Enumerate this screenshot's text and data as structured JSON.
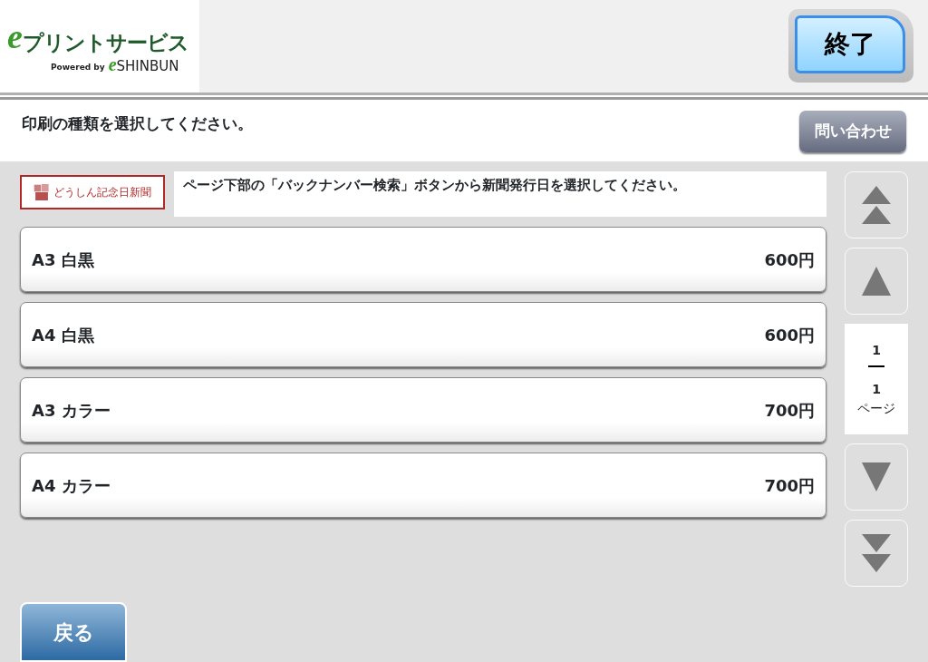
{
  "header": {
    "logo": {
      "mark": "e",
      "title": "プリントサービス",
      "powered_by": "Powered by",
      "brand_mark": "e",
      "brand": "SHINBUN"
    },
    "exit_button": "終了"
  },
  "instruction": "印刷の種類を選択してください。",
  "contact_button": "問い合わせ",
  "notice": {
    "badge": "どうしん記念日新聞",
    "text": "ページ下部の「バックナンバー検索」ボタンから新聞発行日を選択してください。"
  },
  "options": [
    {
      "label": "A3 白黒",
      "price": "600円"
    },
    {
      "label": "A4 白黒",
      "price": "600円"
    },
    {
      "label": "A3 カラー",
      "price": "700円"
    },
    {
      "label": "A4 カラー",
      "price": "700円"
    }
  ],
  "pager": {
    "current": "1",
    "total": "1",
    "unit": "ページ"
  },
  "back_button": "戻る"
}
